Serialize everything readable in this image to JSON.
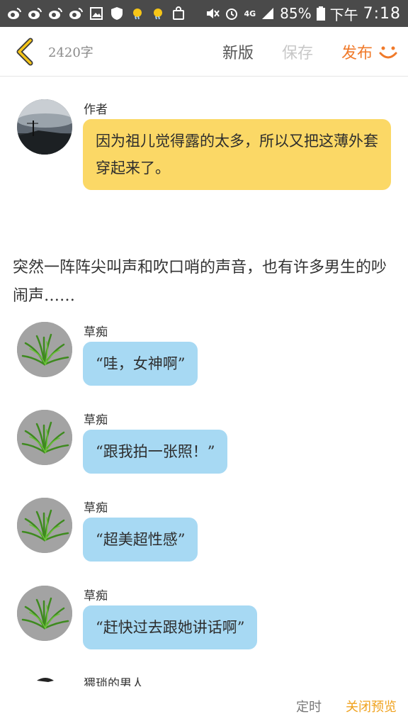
{
  "status_bar": {
    "battery": "85%",
    "network": "4G",
    "time_period": "下午",
    "time": "7:18"
  },
  "toolbar": {
    "word_count": "2420字",
    "new_version": "新版",
    "save": "保存",
    "publish": "发布",
    "colors": {
      "publish": "#f07a2a",
      "save_disabled": "#c8c8c8"
    }
  },
  "messages": [
    {
      "sender": "作者",
      "text": "因为祖儿觉得露的太多，所以又把这薄外套穿起来了。",
      "avatar": "landscape-avatar",
      "bubble_color": "#fbd866"
    }
  ],
  "narration": "突然一阵阵尖叫声和吹口哨的声音，也有许多男生的吵闹声……",
  "crowd_messages": [
    {
      "sender": "草痴",
      "text": "“哇，女神啊”",
      "avatar": "grass-avatar",
      "bubble_color": "#a7d9f3"
    },
    {
      "sender": "草痴",
      "text": "“跟我拍一张照！”",
      "avatar": "grass-avatar",
      "bubble_color": "#a7d9f3"
    },
    {
      "sender": "草痴",
      "text": "“超美超性感”",
      "avatar": "grass-avatar",
      "bubble_color": "#a7d9f3"
    },
    {
      "sender": "草痴",
      "text": "“赶快过去跟她讲话啊”",
      "avatar": "grass-avatar",
      "bubble_color": "#a7d9f3"
    }
  ],
  "partial_message": {
    "sender": "猥琐的男人"
  },
  "bottom_bar": {
    "timer": "定时",
    "close_preview": "关闭预览"
  }
}
